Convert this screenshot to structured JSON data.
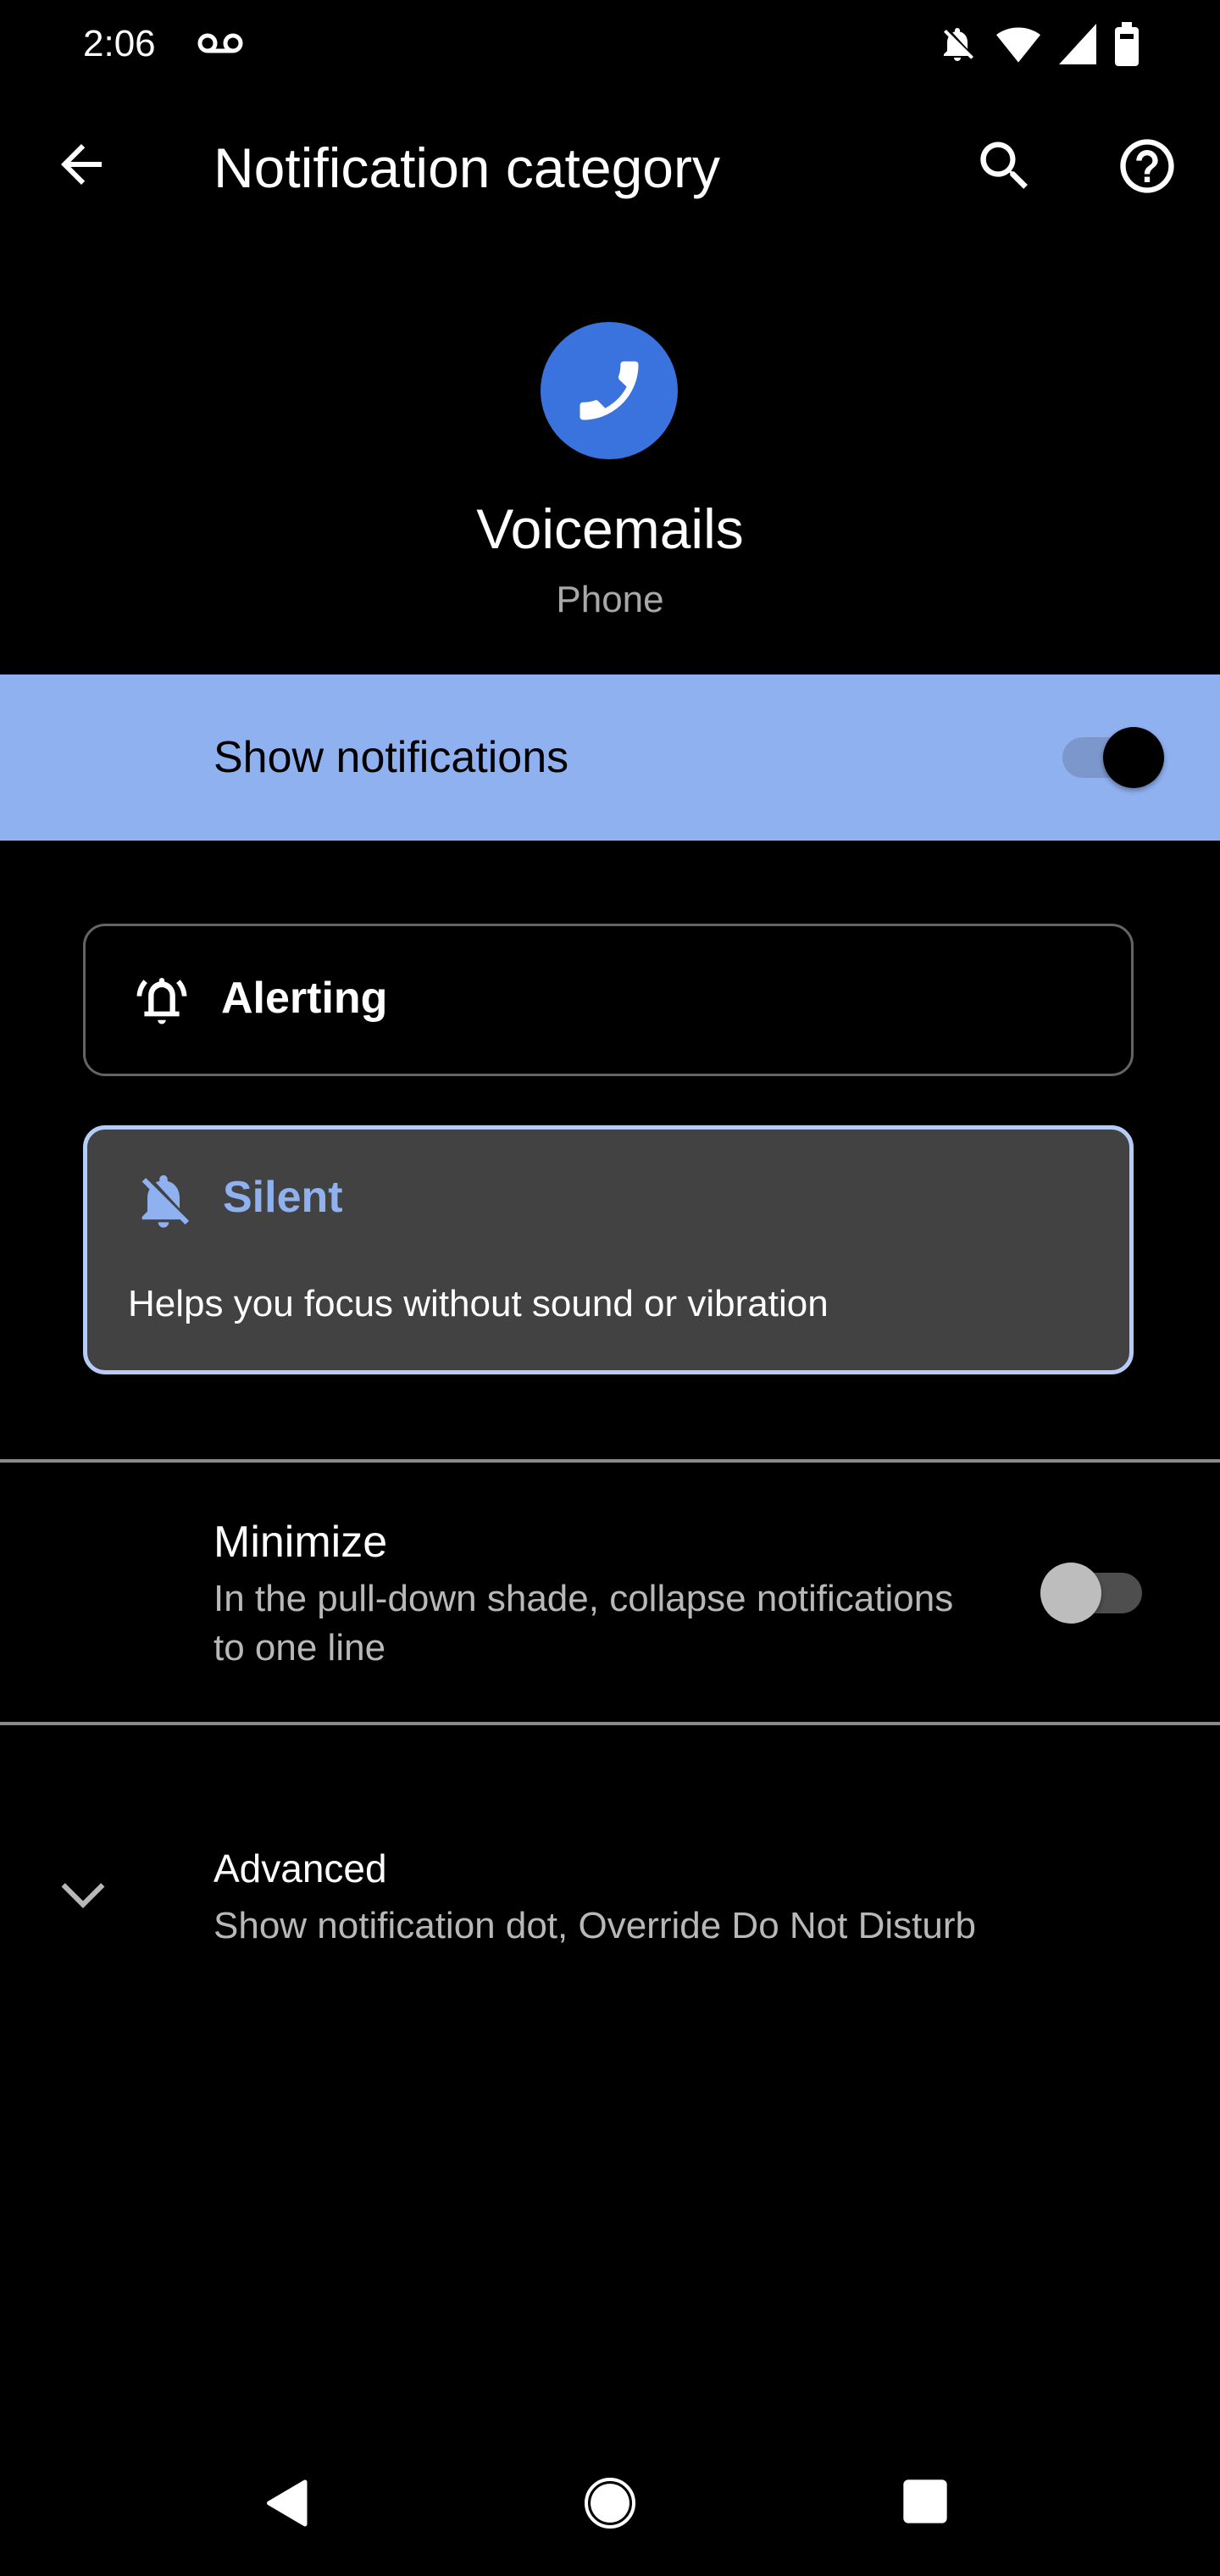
{
  "status_bar": {
    "time": "2:06",
    "left_icons": [
      "voicemail-icon"
    ],
    "right_icons": [
      "notifications-off-icon",
      "wifi-icon",
      "cell-signal-icon",
      "battery-icon"
    ]
  },
  "app_bar": {
    "title": "Notification category",
    "back_icon": "arrow-back-icon",
    "actions": [
      "search-icon",
      "help-icon"
    ]
  },
  "header": {
    "app_icon": "phone-icon",
    "category_name": "Voicemails",
    "app_name": "Phone"
  },
  "show_notifications": {
    "label": "Show notifications",
    "enabled": true,
    "row_color": "#8fb1f0"
  },
  "importance_options": [
    {
      "label": "Alerting",
      "icon": "bell-ringing-icon",
      "selected": false
    },
    {
      "label": "Silent",
      "icon": "bell-off-icon",
      "selected": true,
      "description": "Helps you focus without sound or vibration",
      "accent": "#8fb1f0"
    }
  ],
  "minimize": {
    "title": "Minimize",
    "summary": "In the pull-down shade, collapse notifications to one line",
    "enabled": false
  },
  "advanced": {
    "title": "Advanced",
    "summary": "Show notification dot, Override Do Not Disturb",
    "expanded": false
  },
  "nav_bar": [
    "nav-back-icon",
    "nav-home-icon",
    "nav-recents-icon"
  ]
}
